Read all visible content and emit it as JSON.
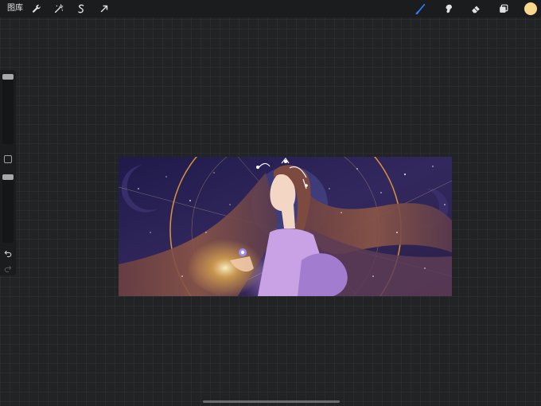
{
  "topbar": {
    "gallery_label": "图库",
    "tools": [
      "wrench-icon",
      "magic-wand-icon",
      "selection-s-icon",
      "arrow-transform-icon"
    ],
    "right_tools": [
      "brush-icon",
      "smudge-icon",
      "eraser-icon",
      "layers-icon"
    ],
    "active_tool": "brush-icon",
    "active_color": "#f8d88a",
    "accent_color": "#2f7cf6"
  },
  "sidebar": {
    "size_slider_level": 0.0,
    "opacity_slider_level": 0.0,
    "buttons": [
      "modify-button",
      "undo-icon",
      "redo-icon"
    ]
  },
  "canvas": {
    "artwork": "illustration"
  }
}
